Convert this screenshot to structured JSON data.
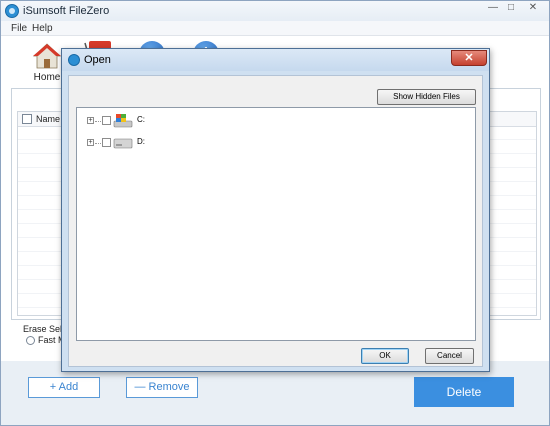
{
  "window": {
    "title": "iSumsoft FileZero",
    "controls": {
      "minimize": "—",
      "maximize": "□",
      "close": "✕"
    }
  },
  "menu": {
    "file": "File",
    "help": "Help"
  },
  "toolbar": {
    "home_label": "Home",
    "home_icon": "house-icon",
    "cart_icon": "cart-icon",
    "help_icon": "question-icon",
    "help_glyph": "?",
    "info_icon": "info-icon",
    "info_glyph": "i"
  },
  "file_list": {
    "columns": [
      "Name"
    ]
  },
  "erase_options": {
    "label": "Erase Select",
    "fast_mode": "Fast Mo"
  },
  "actions": {
    "add": "+  Add",
    "remove": "—  Remove",
    "delete": "Delete"
  },
  "dialog": {
    "title": "Open",
    "close_glyph": "✕",
    "show_hidden": "Show Hidden Files",
    "ok": "OK",
    "cancel": "Cancel",
    "tree": [
      {
        "expander": "+",
        "label": "C:",
        "icon": "system-drive-icon"
      },
      {
        "expander": "+",
        "label": "D:",
        "icon": "disk-drive-icon"
      }
    ]
  },
  "colors": {
    "accent": "#3b8fe0",
    "window_border": "#4d6f95",
    "dialog_bg": "#cfe0f1",
    "close_red": "#c5412f"
  }
}
